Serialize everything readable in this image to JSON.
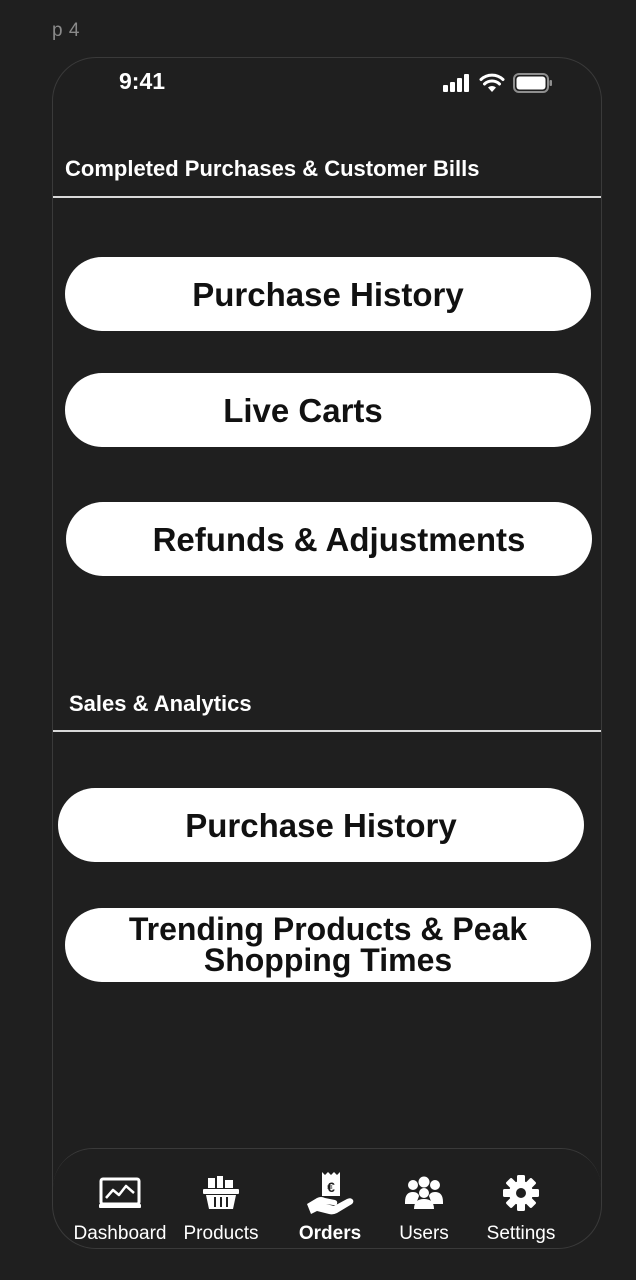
{
  "frame_label": "p 4",
  "status_bar": {
    "time": "9:41",
    "icons": [
      "cellular-signal-icon",
      "wifi-icon",
      "battery-icon"
    ]
  },
  "sections": [
    {
      "title": "Completed Purchases & Customer Bills",
      "buttons": [
        {
          "label": "Purchase History"
        },
        {
          "label": "Live Carts"
        },
        {
          "label": "Refunds & Adjustments"
        }
      ]
    },
    {
      "title": "Sales & Analytics",
      "buttons": [
        {
          "label": "Purchase History"
        },
        {
          "label_line1": "Trending Products & Peak",
          "label_line2": "Shopping Times"
        }
      ]
    }
  ],
  "tabbar": {
    "items": [
      {
        "label": "Dashboard",
        "icon": "chart-monitor-icon",
        "active": false
      },
      {
        "label": "Products",
        "icon": "basket-icon",
        "active": false
      },
      {
        "label": "Orders",
        "icon": "hand-euro-icon",
        "active": true
      },
      {
        "label": "Users",
        "icon": "users-group-icon",
        "active": false
      },
      {
        "label": "Settings",
        "icon": "gear-icon",
        "active": false
      }
    ]
  },
  "colors": {
    "background": "#1f1f1f",
    "button_fill": "#ffffff",
    "button_text": "#111111",
    "text": "#ffffff",
    "frame_label": "#8a8a8a"
  }
}
